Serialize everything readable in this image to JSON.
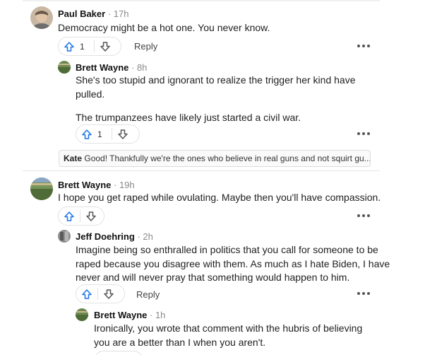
{
  "comments": [
    {
      "author": "Paul Baker",
      "time": "· 17h",
      "text": [
        "Democracy might be a hot one. You never know."
      ],
      "votes": "1",
      "reply_label": "Reply"
    },
    {
      "author": "Brett Wayne",
      "time": "· 8h",
      "text": [
        "She's too stupid and ignorant to realize the trigger her kind have",
        "pulled.",
        "The trumpanzees have likely just started a civil war."
      ],
      "votes": "1"
    },
    {
      "author": "Brett Wayne",
      "time": "· 19h",
      "text": [
        "I hope you get raped while ovulating. Maybe then you'll have compassion."
      ]
    },
    {
      "author": "Jeff Doehring",
      "time": "· 2h",
      "text": [
        "Imagine being so enthralled in politics that you call for someone to be",
        "raped because you disagree with them. As much as I hate Biden, I have",
        "never and will never pray that something would happen to him."
      ],
      "reply_label": "Reply"
    },
    {
      "author": "Brett Wayne",
      "time": "· 1h",
      "text": [
        "Ironically, you wrote that comment with the hubris of believing",
        "you are a better than I when you aren't."
      ]
    }
  ],
  "collapsed_reply": {
    "author": "Kate",
    "text": "Good! Thankfully we're the ones who believe in real guns and not squirt gu..."
  },
  "icons": {
    "upvote": "upvote-arrow-icon",
    "downvote": "downvote-arrow-icon",
    "more": "more-dots-icon"
  },
  "colors": {
    "upvote_accent": "#1a73e8",
    "muted_text": "#8a8a8a"
  }
}
